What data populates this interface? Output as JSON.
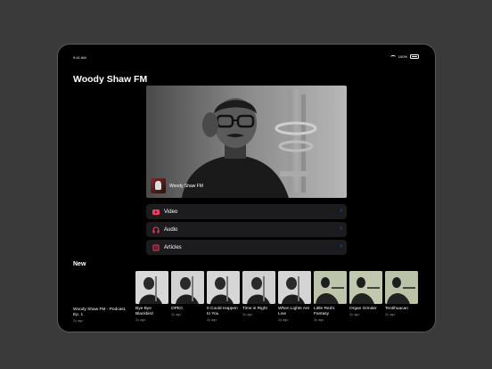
{
  "status": {
    "time": "9:41 AM",
    "battery": "100%"
  },
  "app": {
    "title": "Woody Shaw FM"
  },
  "hero": {
    "station": "Woody Shaw FM"
  },
  "menu": [
    {
      "label": "Video",
      "icon": "video-icon"
    },
    {
      "label": "Audio",
      "icon": "headphones-icon"
    },
    {
      "label": "Articles",
      "icon": "newspaper-icon"
    }
  ],
  "section": {
    "title": "New"
  },
  "episodes": [
    {
      "title": "Woody Shaw FM - Podcast, Ep. 1",
      "subtitle": "2y ago"
    },
    {
      "title": "Bye Bye Blackbird",
      "subtitle": "2y ago"
    },
    {
      "title": "OPEC",
      "subtitle": "2y ago"
    },
    {
      "title": "It Could Happen to You",
      "subtitle": "2y ago"
    },
    {
      "title": "Time is Right",
      "subtitle": "2y ago"
    },
    {
      "title": "When Lights Are Low",
      "subtitle": "2y ago"
    },
    {
      "title": "Little Red's Fantasy",
      "subtitle": "2y ago"
    },
    {
      "title": "Organ Grinder",
      "subtitle": "2y ago"
    },
    {
      "title": "Teotihuacan",
      "subtitle": "2y ago"
    }
  ],
  "colors": {
    "accent": "#0a84ff",
    "icon_red": "#ff375f",
    "row_bg": "#1c1c1e"
  }
}
